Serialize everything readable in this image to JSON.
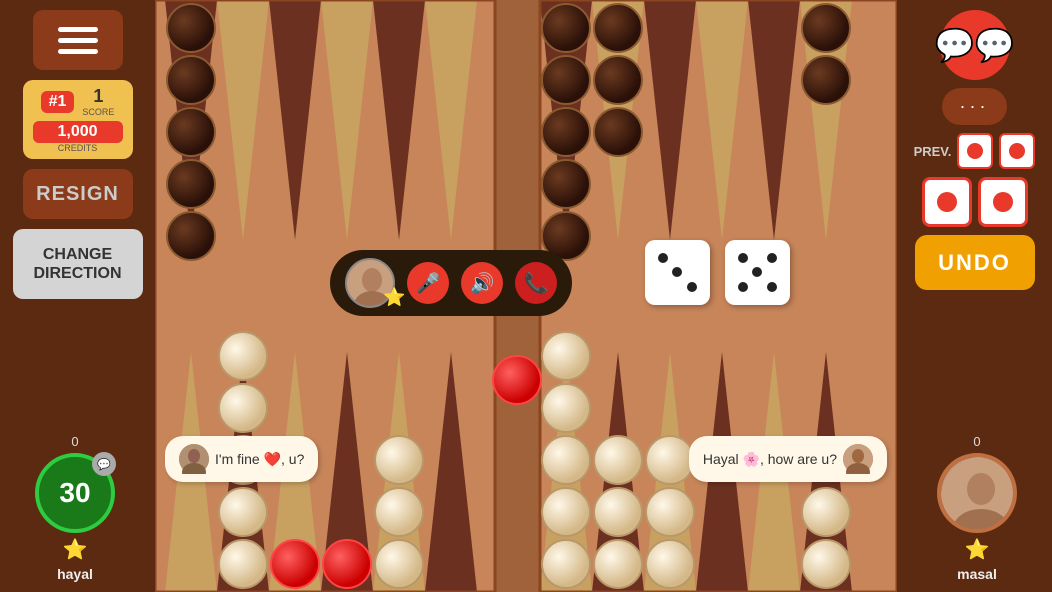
{
  "left_sidebar": {
    "menu_label": "Menu",
    "rank": "#1",
    "score_label": "SCORE",
    "score_value": "1",
    "credits": "1,000",
    "credits_label": "CREDITS",
    "resign_label": "RESIGN",
    "change_direction_label": "CHANGE DIRECTION"
  },
  "right_sidebar": {
    "prev_label": "PREV.",
    "undo_label": "UNDO",
    "dots": "···"
  },
  "left_player": {
    "name": "hayal",
    "timer": "30",
    "score": "0"
  },
  "right_player": {
    "name": "masal",
    "score": "0"
  },
  "board": {
    "dice1": "⚂",
    "dice2": "⚄",
    "prev_die1": "🔴",
    "prev_die2": "🔴"
  },
  "chat": {
    "left_message": "I'm fine ❤️, u?",
    "right_message": "Hayal 🌸, how are u?"
  }
}
